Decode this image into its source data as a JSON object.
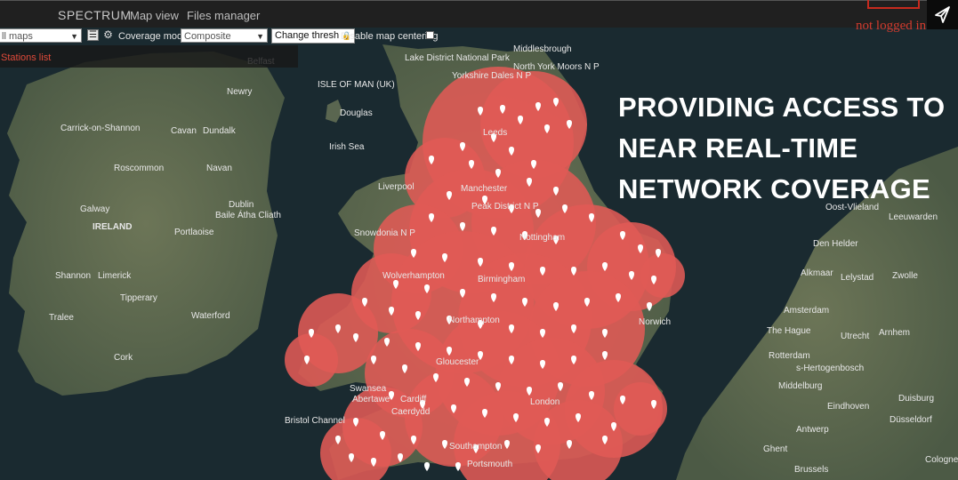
{
  "app": {
    "brand": "SPECTRUM",
    "nav": [
      "Map view",
      "Files manager"
    ]
  },
  "toolbar": {
    "maps_select": "ll maps",
    "coverage_label": "Coverage mode:",
    "coverage_value": "Composite",
    "change_thresh": "Change thresh",
    "disable_centering": "Disable map centering"
  },
  "stations_list": "Stations list",
  "login_status": "not logged in",
  "headline": [
    "PROVIDING ACCESS TO",
    "NEAR REAL-TIME",
    "NETWORK COVERAGE"
  ],
  "colors": {
    "coverage": "#e05a55",
    "marker": "#ffffff",
    "land": "#5e6b52",
    "sea": "#1a2a30",
    "alert": "#d23b2e"
  },
  "map_labels": {
    "ireland": [
      "Belfast",
      "Newry",
      "Carrick-on-Shannon",
      "Cavan",
      "Dundalk",
      "Roscommon",
      "Navan",
      "Galway",
      "IRELAND",
      "Dublin",
      "Baile Átha Cliath",
      "Portlaoise",
      "Shannon",
      "Limerick",
      "Tipperary",
      "Tralee",
      "Waterford",
      "Cork"
    ],
    "uk": [
      "Lake District National Park",
      "Yorkshire Dales N P",
      "North York Moors N P",
      "Middlesbrough",
      "ISLE OF MAN (UK)",
      "Douglas",
      "Irish Sea",
      "Leeds",
      "Liverpool",
      "Manchester",
      "Peak District N P",
      "Snowdonia N P",
      "Nottingham",
      "Wolverhampton",
      "Birmingham",
      "Northampton",
      "Norwich",
      "Gloucester",
      "Swansea",
      "Abertawe",
      "Cardiff",
      "Caerdydd",
      "Bristol Channel",
      "London",
      "Southampton",
      "Portsmouth"
    ],
    "europe": [
      "Oost-Vlieland",
      "Leeuwarden",
      "Den Helder",
      "Alkmaar",
      "Lelystad",
      "Zwolle",
      "Amsterdam",
      "The Hague",
      "Utrecht",
      "Arnhem",
      "Rotterdam",
      "s-Hertogenbosch",
      "Middelburg",
      "Eindhoven",
      "Duisburg",
      "Antwerp",
      "Düsseldorf",
      "Ghent",
      "Brussels",
      "Cologne"
    ]
  }
}
